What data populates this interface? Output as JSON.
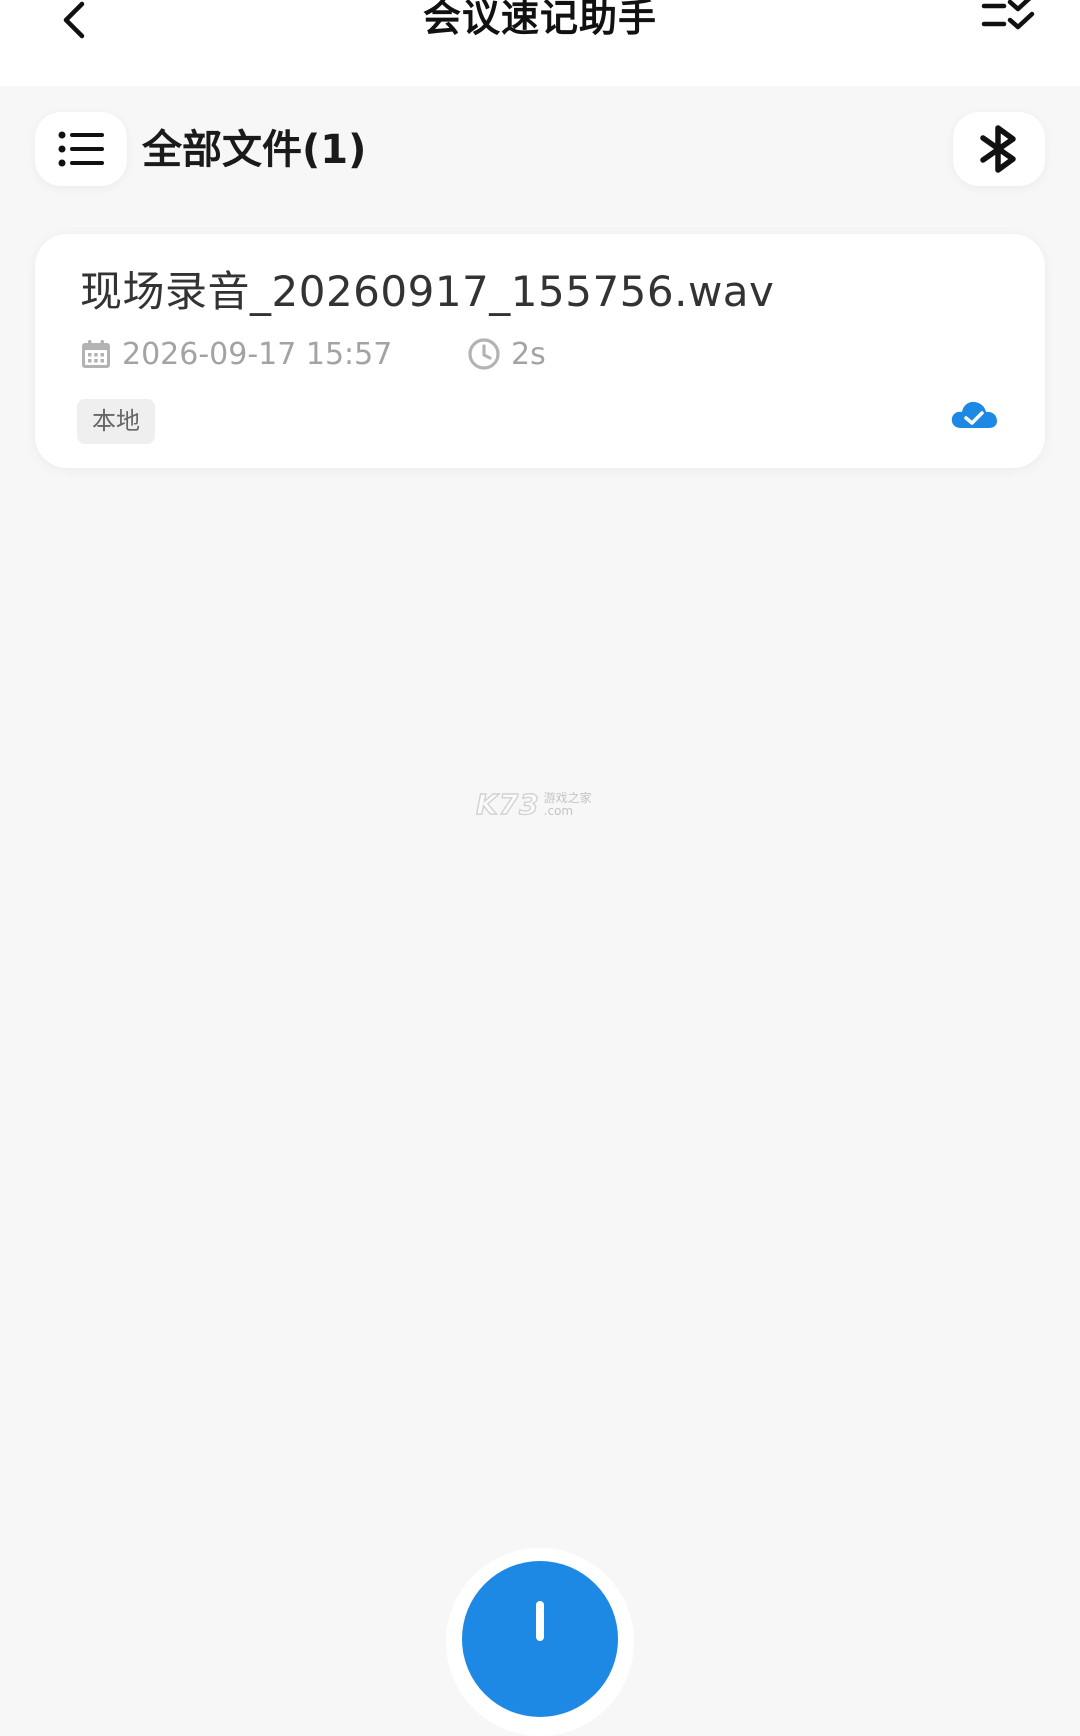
{
  "header": {
    "title": "会议速记助手",
    "back_icon": "chevron-left-icon",
    "checklist_icon": "checklist-icon"
  },
  "toolbar": {
    "list_icon": "list-icon",
    "files_title": "全部文件(1)",
    "bluetooth_icon": "bluetooth-icon"
  },
  "files": [
    {
      "name": "现场录音_20260917_155756.wav",
      "date": "2026-09-17 15:57",
      "duration": "2s",
      "tag": "本地",
      "cloud_status_icon": "cloud-check-icon"
    }
  ],
  "watermark": {
    "big": "K73",
    "small_top": "游戏之家",
    "small_bottom": ".com"
  },
  "fab": {
    "icon": "plus-icon"
  },
  "colors": {
    "accent": "#1e88e5",
    "background": "#f7f7f7",
    "card": "#ffffff",
    "meta_text": "#a3a3a3"
  }
}
